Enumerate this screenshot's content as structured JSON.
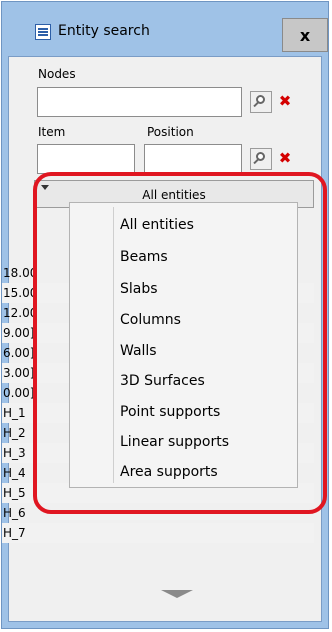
{
  "window": {
    "title": "Entity search",
    "close_glyph": "x"
  },
  "form": {
    "nodes_label": "Nodes",
    "nodes_value": "",
    "item_label": "Item",
    "item_value": "",
    "position_label": "Position",
    "position_value": ""
  },
  "filter": {
    "selected": "All entities"
  },
  "results": {
    "rows": [
      "18.00",
      "15.00",
      "12.00",
      "9.00]",
      "6.00]",
      "3.00]",
      "0.00]",
      "H_1",
      "H_2",
      "H_3",
      "H_4",
      "H_5",
      "H_6",
      "H_7"
    ]
  },
  "menu": {
    "items": [
      "All entities",
      "Beams",
      "Slabs",
      "Columns",
      "Walls",
      "3D Surfaces",
      "Point supports",
      "Linear supports",
      "Area supports"
    ]
  },
  "colors": {
    "titlebar": "#9fc2e7",
    "highlight": "#e01621",
    "delete_icon": "#d40000"
  },
  "icons": {
    "app": "app-icon",
    "search": "search-icon",
    "delete": "delete-icon",
    "scroll_down": "chevron-down-icon"
  }
}
